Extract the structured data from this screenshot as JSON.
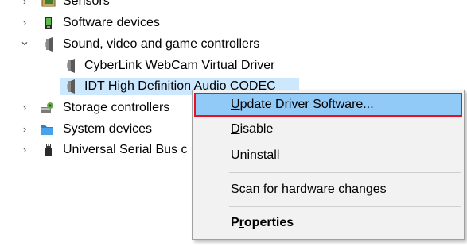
{
  "tree": {
    "items": [
      {
        "label": "Sensors",
        "icon": "sensors-icon",
        "chevron": "›"
      },
      {
        "label": "Software devices",
        "icon": "software-device-icon",
        "chevron": "›"
      },
      {
        "label": "Sound, video and game controllers",
        "icon": "speaker-icon",
        "chevron": "⌄"
      },
      {
        "label": "CyberLink WebCam Virtual Driver",
        "icon": "speaker-icon",
        "chevron": ""
      },
      {
        "label": "IDT High Definition Audio CODEC",
        "icon": "speaker-icon",
        "chevron": ""
      },
      {
        "label": "Storage controllers",
        "icon": "storage-controller-icon",
        "chevron": "›"
      },
      {
        "label": "System devices",
        "icon": "folder-icon",
        "chevron": "›"
      },
      {
        "label": "Universal Serial Bus c",
        "icon": "usb-icon",
        "chevron": "›"
      }
    ]
  },
  "context_menu": {
    "items": [
      {
        "pre": "",
        "ul": "U",
        "post": "pdate Driver Software..."
      },
      {
        "pre": "",
        "ul": "D",
        "post": "isable"
      },
      {
        "pre": "",
        "ul": "U",
        "post": "ninstall"
      },
      {
        "pre": "Sc",
        "ul": "a",
        "post": "n for hardware changes"
      },
      {
        "pre": "P",
        "ul": "r",
        "post": "operties"
      }
    ]
  },
  "colors": {
    "menu_highlight": "#91c9f7",
    "highlight_border": "#e81123",
    "selection": "#cce8ff"
  }
}
